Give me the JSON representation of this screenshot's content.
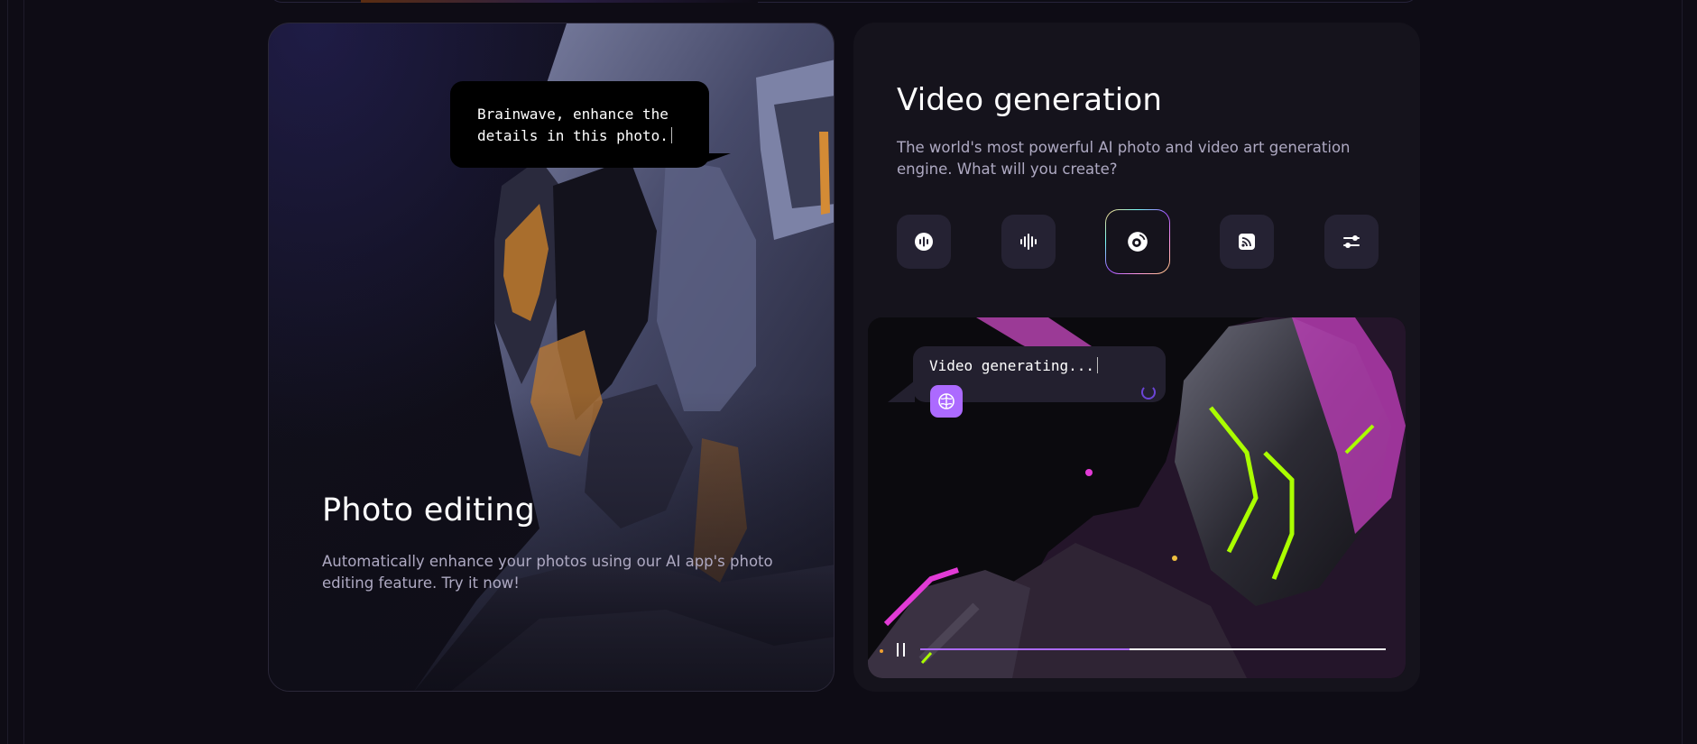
{
  "photo_card": {
    "bubble_text": "Brainwave, enhance the details in this photo.",
    "title": "Photo editing",
    "description": "Automatically enhance your photos using our AI app's photo editing feature. Try it now!"
  },
  "video_card": {
    "title": "Video generation",
    "description": "The world's most powerful AI photo and video art generation engine. What will you create?",
    "tools": [
      {
        "icon": "record-icon",
        "active": false
      },
      {
        "icon": "soundwave-icon",
        "active": false
      },
      {
        "icon": "disc-icon",
        "active": true
      },
      {
        "icon": "cast-icon",
        "active": false
      },
      {
        "icon": "sliders-icon",
        "active": false
      }
    ],
    "video": {
      "status_text": "Video generating...",
      "progress": 0.45
    }
  },
  "colors": {
    "background": "#0e0c15",
    "card": "#15131c",
    "accent_purple": "#ac6aff",
    "neon_green": "#aaff00",
    "neon_magenta": "#e23bd6"
  }
}
